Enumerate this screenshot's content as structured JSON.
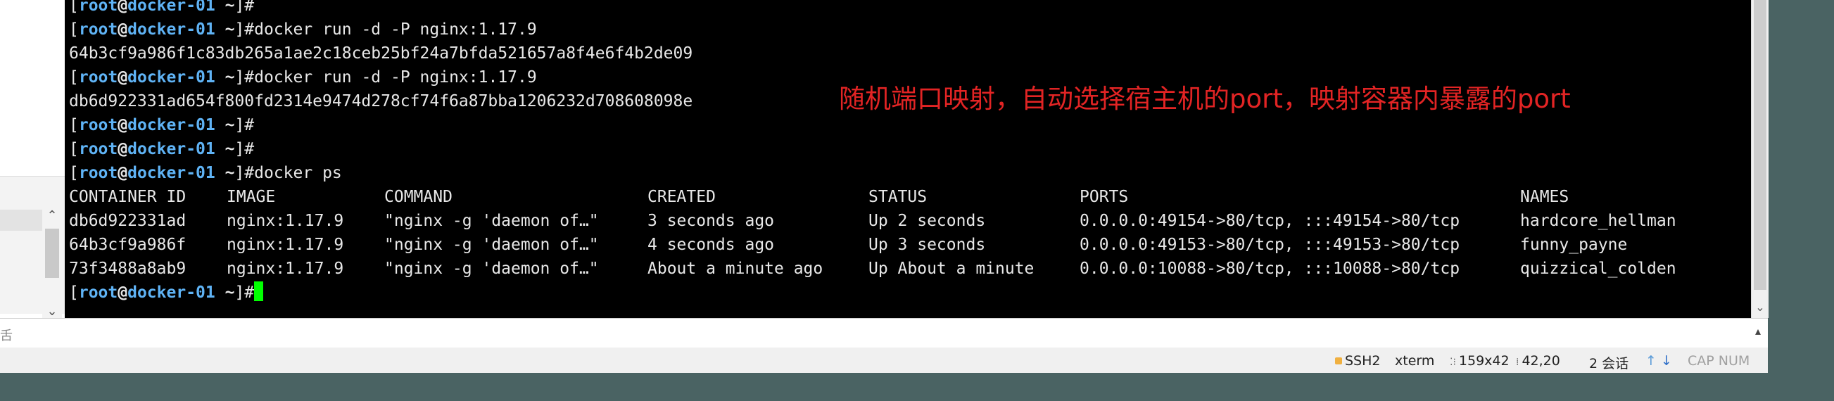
{
  "prompt": {
    "open_bracket": "[",
    "user": "root",
    "at": "@",
    "host": "docker-01",
    "dir": " ~",
    "close": "]#"
  },
  "terminal": {
    "lines": [
      {
        "type": "prompt",
        "cmd": ""
      },
      {
        "type": "prompt",
        "cmd": "docker run -d -P nginx:1.17.9"
      },
      {
        "type": "output",
        "text": "64b3cf9a986f1c83db265a1ae2c18ceb25bf24a7bfda521657a8f4e6f4b2de09"
      },
      {
        "type": "prompt",
        "cmd": "docker run -d -P nginx:1.17.9"
      },
      {
        "type": "output",
        "text": "db6d922331ad654f800fd2314e9474d278cf74f6a87bba1206232d708608098e"
      },
      {
        "type": "prompt",
        "cmd": ""
      },
      {
        "type": "prompt",
        "cmd": ""
      },
      {
        "type": "prompt",
        "cmd": "docker ps"
      }
    ],
    "table_headers": [
      "CONTAINER ID",
      "IMAGE",
      "COMMAND",
      "CREATED",
      "STATUS",
      "PORTS",
      "NAMES"
    ],
    "table_rows": [
      [
        "db6d922331ad",
        "nginx:1.17.9",
        "\"nginx -g 'daemon of…\"",
        "3 seconds ago",
        "Up 2 seconds",
        "0.0.0.0:49154->80/tcp, :::49154->80/tcp",
        "hardcore_hellman"
      ],
      [
        "64b3cf9a986f",
        "nginx:1.17.9",
        "\"nginx -g 'daemon of…\"",
        "4 seconds ago",
        "Up 3 seconds",
        "0.0.0.0:49153->80/tcp, :::49153->80/tcp",
        "funny_payne"
      ],
      [
        "73f3488a8ab9",
        "nginx:1.17.9",
        "\"nginx -g 'daemon of…\"",
        "About a minute ago",
        "Up About a minute",
        "0.0.0.0:10088->80/tcp, :::10088->80/tcp",
        "quizzical_colden"
      ]
    ],
    "annotation": "随机端口映射，自动选择宿主机的port，映射容器内暴露的port",
    "cursor_color": "#00ff00"
  },
  "input_bar": {
    "label": "舌"
  },
  "status_bar": {
    "protocol": "SSH2",
    "term_type": "xterm",
    "size": "159x42",
    "position": "42,20",
    "sessions": "2 会话",
    "caps": "CAP NUM"
  },
  "icons": {
    "lock": "lock-icon",
    "size": "resize-icon",
    "position": "cursor-position-icon",
    "up": "arrow-up-icon",
    "down": "arrow-down-icon"
  },
  "colors": {
    "background": "#4a6363",
    "terminal_bg": "#000000",
    "prompt_blue": "#5fb3f5",
    "annotation_red": "#e22424"
  }
}
